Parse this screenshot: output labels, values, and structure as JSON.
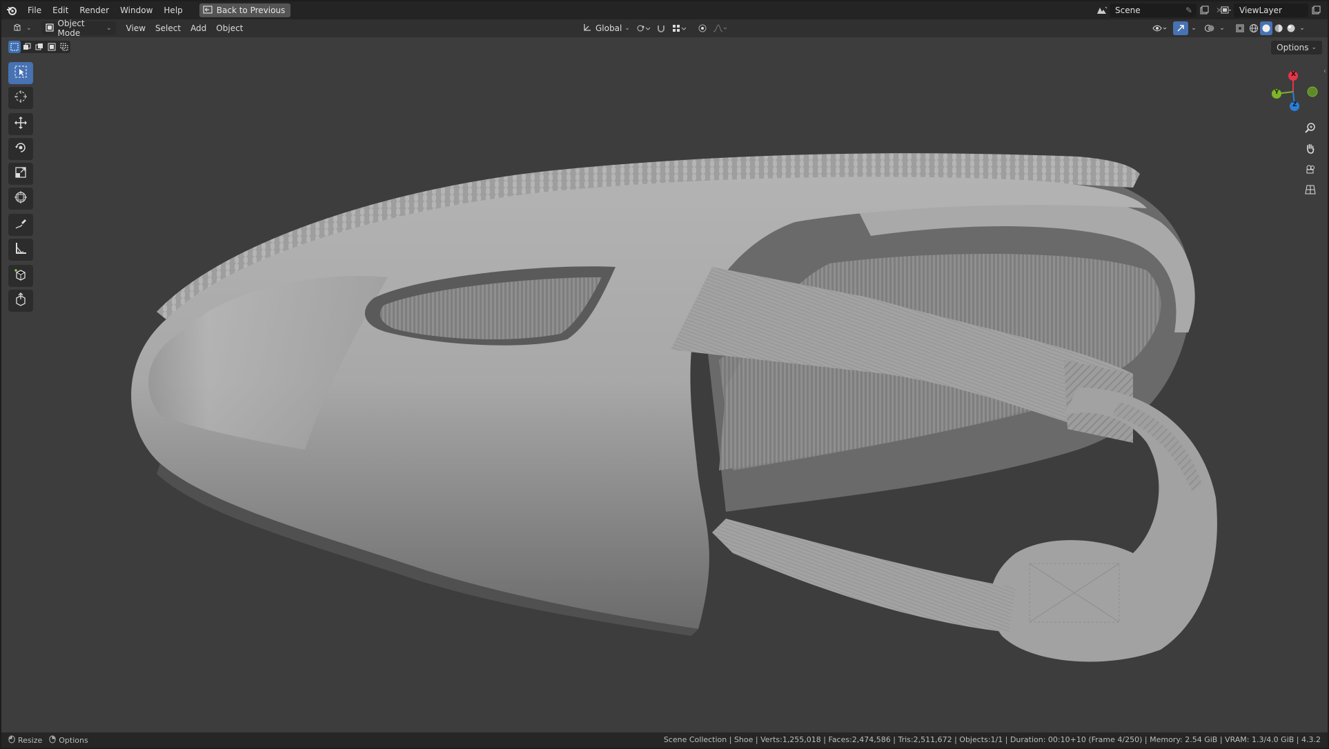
{
  "menu": {
    "file": "File",
    "edit": "Edit",
    "render": "Render",
    "window": "Window",
    "help": "Help",
    "back_to_previous": "Back to Previous"
  },
  "scene": {
    "name": "Scene"
  },
  "view_layer": {
    "name": "ViewLayer"
  },
  "header": {
    "mode": "Object Mode",
    "view": "View",
    "select": "Select",
    "add": "Add",
    "object": "Object",
    "orientation": "Global",
    "options": "Options"
  },
  "gizmo": {
    "x": "X",
    "y": "Y",
    "z": "Z"
  },
  "status": {
    "resize": "Resize",
    "options": "Options",
    "stats": "Scene Collection | Shoe | Verts:1,255,018 | Faces:2,474,586 | Tris:2,511,672 | Objects:1/1 | Duration: 00:10+10 (Frame 4/250) | Memory: 2.54 GiB | VRAM: 1.3/4.0 GiB | 4.3.2"
  },
  "colors": {
    "accent": "#4772b3",
    "axis_x": "#e2364a",
    "axis_y": "#7fb42a",
    "axis_z": "#2c7ed6"
  }
}
